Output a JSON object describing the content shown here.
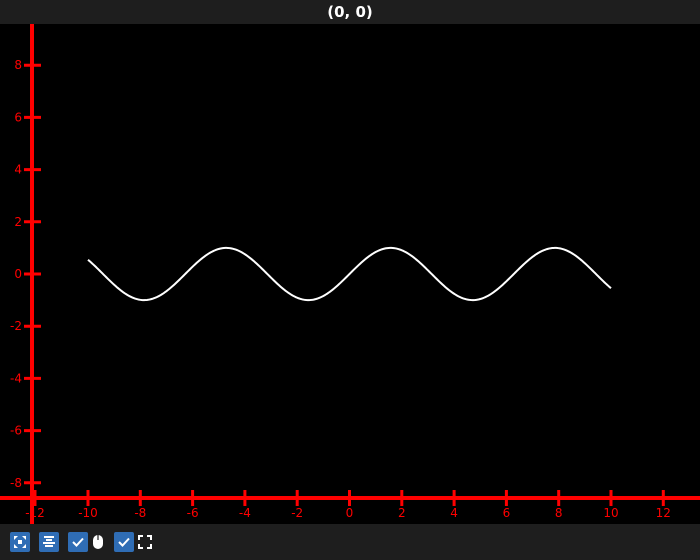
{
  "window": {
    "title": "(0, 0)"
  },
  "colors": {
    "axis": "#ff0000",
    "curve": "#ffffff",
    "background": "#000000",
    "toolbar_button": "#2f6db5"
  },
  "toolbar": {
    "buttons": [
      {
        "icon": "fit-view-icon"
      },
      {
        "icon": "align-center-icon"
      },
      {
        "icon": "checkbox-icon",
        "checked": true,
        "companion_icon": "mouse-icon"
      },
      {
        "icon": "checkbox-icon",
        "checked": true,
        "companion_icon": "fullscreen-icon"
      }
    ]
  },
  "chart_data": {
    "type": "line",
    "title": "",
    "xlabel": "",
    "ylabel": "",
    "xlim": [
      -12,
      13
    ],
    "ylim": [
      -8.5,
      9
    ],
    "x_ticks": [
      -12,
      -10,
      -8,
      -6,
      -4,
      -2,
      0,
      2,
      4,
      6,
      8,
      10,
      12
    ],
    "y_ticks": [
      -8,
      -6,
      -4,
      -2,
      0,
      2,
      4,
      6,
      8
    ],
    "grid": false,
    "series": [
      {
        "function": "sin",
        "x_range": [
          -10,
          10
        ],
        "x": [
          -10,
          -9,
          -8,
          -7,
          -6,
          -5,
          -4,
          -3,
          -2,
          -1,
          0,
          1,
          2,
          3,
          4,
          5,
          6,
          7,
          8,
          9,
          10
        ],
        "values": [
          0.544,
          -0.412,
          -0.989,
          -0.657,
          0.279,
          0.959,
          0.757,
          -0.141,
          -0.909,
          -0.841,
          0,
          0.841,
          0.909,
          0.141,
          -0.757,
          -0.959,
          -0.279,
          0.657,
          0.989,
          0.412,
          -0.544
        ]
      }
    ]
  }
}
